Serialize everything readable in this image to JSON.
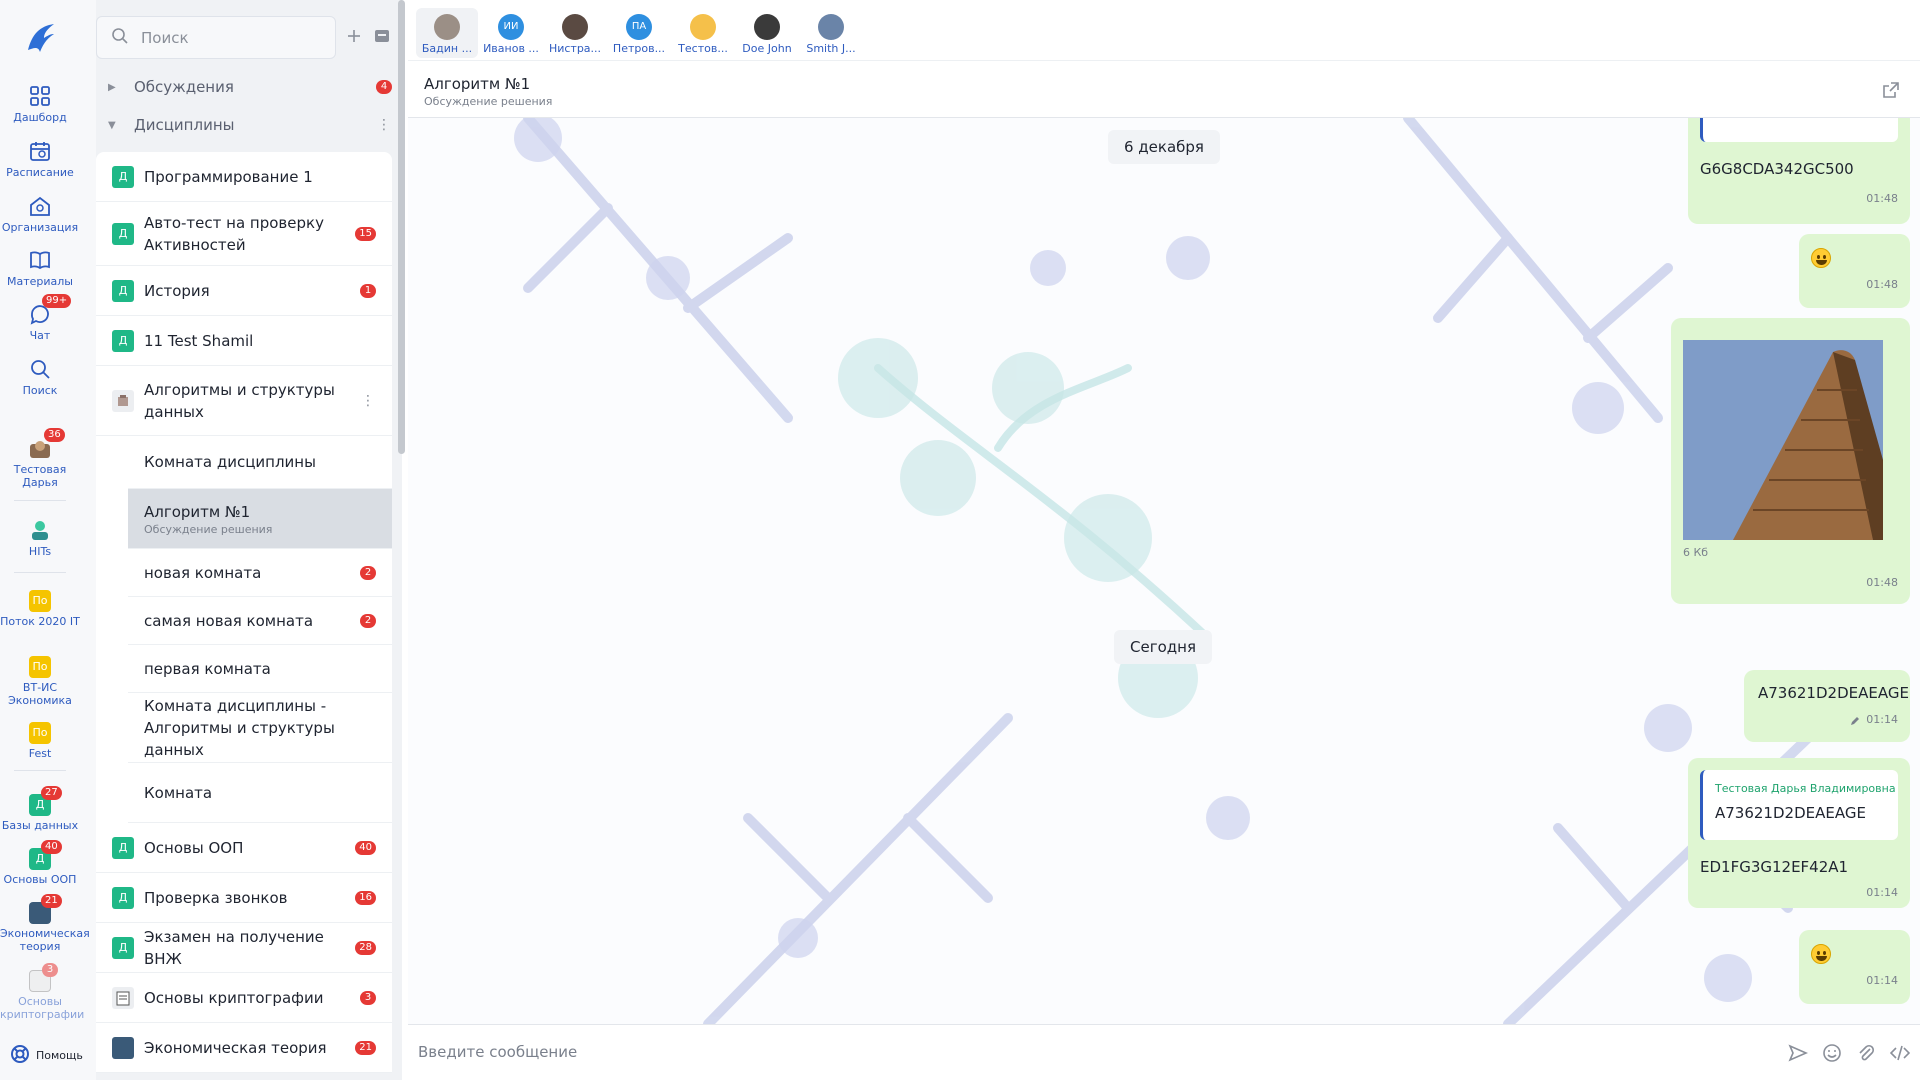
{
  "rail": {
    "items": [
      {
        "label": "Дашборд",
        "icon": "dashboard-icon"
      },
      {
        "label": "Расписание",
        "icon": "calendar-icon"
      },
      {
        "label": "Организация",
        "icon": "organization-icon"
      },
      {
        "label": "Материалы",
        "icon": "book-icon"
      },
      {
        "label": "Чат",
        "icon": "chat-icon",
        "badge": "99+"
      },
      {
        "label": "Поиск",
        "icon": "search-icon"
      },
      {
        "label": "Тестовая Дарья",
        "icon": "user-avatar",
        "badge": "36"
      },
      {
        "label": "HITs",
        "icon": "hits-avatar"
      },
      {
        "label": "Поток 2020 IT",
        "avatar": "По"
      },
      {
        "label": "ВТ-ИС Экономика",
        "avatar": "По"
      },
      {
        "label": "Fest",
        "avatar": "По"
      },
      {
        "label": "Базы данных",
        "avatar": "Д",
        "badge": "27"
      },
      {
        "label": "Основы ООП",
        "avatar": "Д",
        "badge": "40"
      },
      {
        "label": "Экономическая теория",
        "icon": "image-avatar",
        "badge": "21"
      },
      {
        "label": "Основы криптографии",
        "icon": "document-avatar",
        "badge": "3"
      }
    ],
    "help": "Помощь"
  },
  "sidebar": {
    "search_placeholder": "Поиск",
    "groups": [
      {
        "label": "Обсуждения",
        "badge": "4"
      },
      {
        "label": "Дисциплины"
      }
    ],
    "items": [
      {
        "tag": "Д",
        "title": "Программирование 1"
      },
      {
        "tag": "Д",
        "title": "Авто-тест на проверку Активностей",
        "badge": "15"
      },
      {
        "tag": "Д",
        "title": "История",
        "badge": "1"
      },
      {
        "tag": "Д",
        "title": "11 Test Shamil"
      },
      {
        "tag": "",
        "title": "Алгоритмы и структуры данных"
      }
    ],
    "subitems": [
      {
        "title": "Комната дисциплины"
      },
      {
        "title": "Алгоритм №1",
        "subtitle": "Обсуждение решения"
      },
      {
        "title": "новая комната",
        "badge": "2"
      },
      {
        "title": "самая новая комната",
        "badge": "2"
      },
      {
        "title": "первая комната"
      },
      {
        "title": "Комната дисциплины - Алгоритмы и структуры данных"
      },
      {
        "title": "Комната"
      }
    ],
    "items2": [
      {
        "tag": "Д",
        "title": "Основы ООП",
        "badge": "40"
      },
      {
        "tag": "Д",
        "title": "Проверка звонков",
        "badge": "16"
      },
      {
        "tag": "Д",
        "title": "Экзамен на получение ВНЖ",
        "badge": "28"
      },
      {
        "tag": "",
        "title": "Основы криптографии",
        "badge": "3"
      },
      {
        "tag": "",
        "title": "Экономическая теория",
        "badge": "21"
      }
    ]
  },
  "participants": [
    {
      "name": "Бадин ...",
      "initials": "",
      "color": "#9b8f86"
    },
    {
      "name": "Иванов ...",
      "initials": "ИИ",
      "color": "#2e8fe0"
    },
    {
      "name": "Нистра...",
      "initials": "",
      "color": "#5a4a42"
    },
    {
      "name": "Петров...",
      "initials": "ПА",
      "color": "#2e8fe0"
    },
    {
      "name": "Тестов...",
      "initials": "",
      "color": "#f5c04a"
    },
    {
      "name": "Doe John",
      "initials": "",
      "color": "#3a3a3a"
    },
    {
      "name": "Smith J...",
      "initials": "",
      "color": "#6a84a8"
    }
  ],
  "chat": {
    "title": "Алгоритм №1",
    "subtitle": "Обсуждение решения",
    "date1": "6 декабря",
    "date2": "Сегодня",
    "messages": [
      {
        "text": "G6G8CDA342GC500",
        "time": "01:48"
      },
      {
        "text": "",
        "emoji": "grinning-emoji",
        "time": "01:48"
      },
      {
        "image_caption": "6 Кб",
        "time": "01:48"
      },
      {
        "text": "A73621D2DEAEAGE",
        "time": "01:14",
        "edited": true
      },
      {
        "quote_author": "Тестовая Дарья Владимировна",
        "quote_text": "A73621D2DEAEAGE",
        "text": "ED1FG3G12EF42A1",
        "time": "01:14"
      },
      {
        "text": "",
        "emoji": "laughing-emoji",
        "time": "01:14"
      }
    ]
  },
  "composer": {
    "placeholder": "Введите сообщение"
  },
  "colors": {
    "accent": "#2e5bbf",
    "discipline_tag": "#1fb887",
    "badge": "#e53935",
    "bubble": "#dff6d2"
  }
}
